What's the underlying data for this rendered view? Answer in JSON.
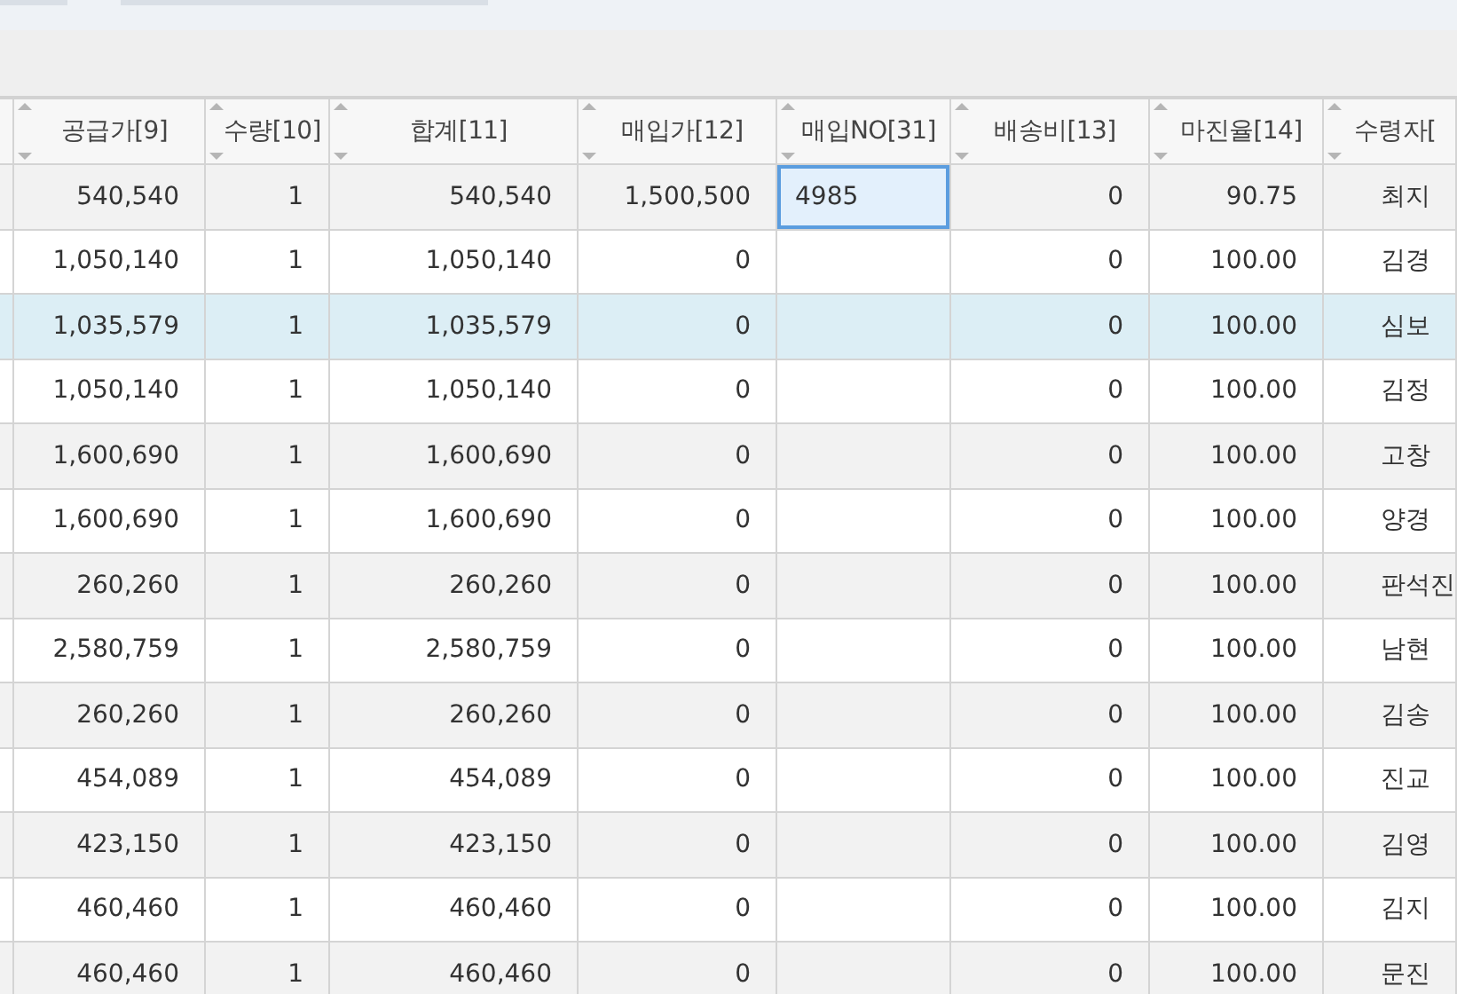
{
  "table": {
    "columns": [
      "공급가[9]",
      "수량[10]",
      "합계[11]",
      "매입가[12]",
      "매입NO[31]",
      "배송비[13]",
      "마진율[14]",
      "수령자["
    ],
    "rows": [
      {
        "cells": [
          "540,540",
          "1",
          "540,540",
          "1,500,500",
          "4985",
          "0",
          "90.75",
          "최지"
        ],
        "selected": false,
        "purchase_no_focused": true
      },
      {
        "cells": [
          "1,050,140",
          "1",
          "1,050,140",
          "0",
          "",
          "0",
          "100.00",
          "김경"
        ],
        "selected": false,
        "purchase_no_focused": false
      },
      {
        "cells": [
          "1,035,579",
          "1",
          "1,035,579",
          "0",
          "",
          "0",
          "100.00",
          "심보"
        ],
        "selected": true,
        "purchase_no_focused": false
      },
      {
        "cells": [
          "1,050,140",
          "1",
          "1,050,140",
          "0",
          "",
          "0",
          "100.00",
          "김정"
        ],
        "selected": false,
        "purchase_no_focused": false
      },
      {
        "cells": [
          "1,600,690",
          "1",
          "1,600,690",
          "0",
          "",
          "0",
          "100.00",
          "고창"
        ],
        "selected": false,
        "purchase_no_focused": false
      },
      {
        "cells": [
          "1,600,690",
          "1",
          "1,600,690",
          "0",
          "",
          "0",
          "100.00",
          "양경"
        ],
        "selected": false,
        "purchase_no_focused": false
      },
      {
        "cells": [
          "260,260",
          "1",
          "260,260",
          "0",
          "",
          "0",
          "100.00",
          "판석진"
        ],
        "selected": false,
        "purchase_no_focused": false
      },
      {
        "cells": [
          "2,580,759",
          "1",
          "2,580,759",
          "0",
          "",
          "0",
          "100.00",
          "남현"
        ],
        "selected": false,
        "purchase_no_focused": false
      },
      {
        "cells": [
          "260,260",
          "1",
          "260,260",
          "0",
          "",
          "0",
          "100.00",
          "김송"
        ],
        "selected": false,
        "purchase_no_focused": false
      },
      {
        "cells": [
          "454,089",
          "1",
          "454,089",
          "0",
          "",
          "0",
          "100.00",
          "진교"
        ],
        "selected": false,
        "purchase_no_focused": false
      },
      {
        "cells": [
          "423,150",
          "1",
          "423,150",
          "0",
          "",
          "0",
          "100.00",
          "김영"
        ],
        "selected": false,
        "purchase_no_focused": false
      },
      {
        "cells": [
          "460,460",
          "1",
          "460,460",
          "0",
          "",
          "0",
          "100.00",
          "김지"
        ],
        "selected": false,
        "purchase_no_focused": false
      },
      {
        "cells": [
          "460,460",
          "1",
          "460,460",
          "0",
          "",
          "0",
          "100.00",
          "문진"
        ],
        "selected": false,
        "purchase_no_focused": false
      }
    ]
  }
}
